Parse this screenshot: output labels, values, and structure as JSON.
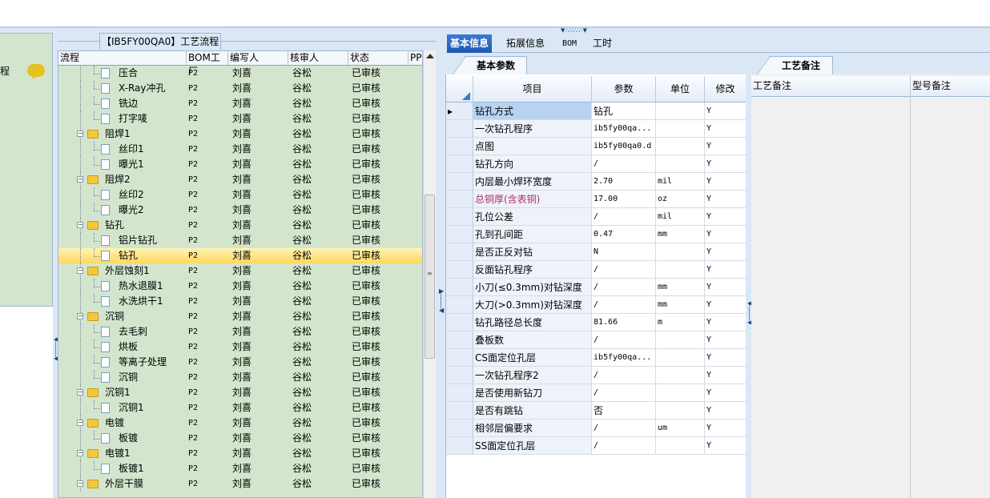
{
  "process_panel": {
    "title": "【IB5FY00QA0】工艺流程",
    "columns": [
      "流程",
      "BOM工厂",
      "编写人",
      "核审人",
      "状态",
      "PP"
    ],
    "rows": [
      {
        "name": "压合",
        "level": 2,
        "type": "doc",
        "bom": "P2",
        "author": "刘喜",
        "reviewer": "谷松",
        "status": "已审核"
      },
      {
        "name": "X-Ray冲孔",
        "level": 2,
        "type": "doc",
        "bom": "P2",
        "author": "刘喜",
        "reviewer": "谷松",
        "status": "已审核"
      },
      {
        "name": "铣边",
        "level": 2,
        "type": "doc",
        "bom": "P2",
        "author": "刘喜",
        "reviewer": "谷松",
        "status": "已审核"
      },
      {
        "name": "打字唛",
        "level": 2,
        "type": "doc",
        "bom": "P2",
        "author": "刘喜",
        "reviewer": "谷松",
        "status": "已审核"
      },
      {
        "name": "阻焊1",
        "level": 1,
        "type": "folder",
        "bom": "P2",
        "author": "刘喜",
        "reviewer": "谷松",
        "status": "已审核"
      },
      {
        "name": "丝印1",
        "level": 2,
        "type": "doc",
        "bom": "P2",
        "author": "刘喜",
        "reviewer": "谷松",
        "status": "已审核"
      },
      {
        "name": "曝光1",
        "level": 2,
        "type": "doc",
        "bom": "P2",
        "author": "刘喜",
        "reviewer": "谷松",
        "status": "已审核"
      },
      {
        "name": "阻焊2",
        "level": 1,
        "type": "folder",
        "bom": "P2",
        "author": "刘喜",
        "reviewer": "谷松",
        "status": "已审核"
      },
      {
        "name": "丝印2",
        "level": 2,
        "type": "doc",
        "bom": "P2",
        "author": "刘喜",
        "reviewer": "谷松",
        "status": "已审核"
      },
      {
        "name": "曝光2",
        "level": 2,
        "type": "doc",
        "bom": "P2",
        "author": "刘喜",
        "reviewer": "谷松",
        "status": "已审核"
      },
      {
        "name": "钻孔",
        "level": 1,
        "type": "folder",
        "bom": "P2",
        "author": "刘喜",
        "reviewer": "谷松",
        "status": "已审核"
      },
      {
        "name": "铝片钻孔",
        "level": 2,
        "type": "doc",
        "bom": "P2",
        "author": "刘喜",
        "reviewer": "谷松",
        "status": "已审核"
      },
      {
        "name": "钻孔",
        "level": 2,
        "type": "doc",
        "bom": "P2",
        "author": "刘喜",
        "reviewer": "谷松",
        "status": "已审核",
        "selected": true
      },
      {
        "name": "外层蚀刻1",
        "level": 1,
        "type": "folder",
        "bom": "P2",
        "author": "刘喜",
        "reviewer": "谷松",
        "status": "已审核"
      },
      {
        "name": "热水退膜1",
        "level": 2,
        "type": "doc",
        "bom": "P2",
        "author": "刘喜",
        "reviewer": "谷松",
        "status": "已审核"
      },
      {
        "name": "水洗烘干1",
        "level": 2,
        "type": "doc",
        "bom": "P2",
        "author": "刘喜",
        "reviewer": "谷松",
        "status": "已审核"
      },
      {
        "name": "沉铜",
        "level": 1,
        "type": "folder",
        "bom": "P2",
        "author": "刘喜",
        "reviewer": "谷松",
        "status": "已审核"
      },
      {
        "name": "去毛刺",
        "level": 2,
        "type": "doc",
        "bom": "P2",
        "author": "刘喜",
        "reviewer": "谷松",
        "status": "已审核"
      },
      {
        "name": "烘板",
        "level": 2,
        "type": "doc",
        "bom": "P2",
        "author": "刘喜",
        "reviewer": "谷松",
        "status": "已审核"
      },
      {
        "name": "等离子处理",
        "level": 2,
        "type": "doc",
        "bom": "P2",
        "author": "刘喜",
        "reviewer": "谷松",
        "status": "已审核"
      },
      {
        "name": "沉铜",
        "level": 2,
        "type": "doc",
        "bom": "P2",
        "author": "刘喜",
        "reviewer": "谷松",
        "status": "已审核"
      },
      {
        "name": "沉铜1",
        "level": 1,
        "type": "folder",
        "bom": "P2",
        "author": "刘喜",
        "reviewer": "谷松",
        "status": "已审核"
      },
      {
        "name": "沉铜1",
        "level": 2,
        "type": "doc",
        "bom": "P2",
        "author": "刘喜",
        "reviewer": "谷松",
        "status": "已审核"
      },
      {
        "name": "电镀",
        "level": 1,
        "type": "folder",
        "bom": "P2",
        "author": "刘喜",
        "reviewer": "谷松",
        "status": "已审核"
      },
      {
        "name": "板镀",
        "level": 2,
        "type": "doc",
        "bom": "P2",
        "author": "刘喜",
        "reviewer": "谷松",
        "status": "已审核"
      },
      {
        "name": "电镀1",
        "level": 1,
        "type": "folder",
        "bom": "P2",
        "author": "刘喜",
        "reviewer": "谷松",
        "status": "已审核"
      },
      {
        "name": "板镀1",
        "level": 2,
        "type": "doc",
        "bom": "P2",
        "author": "刘喜",
        "reviewer": "谷松",
        "status": "已审核"
      },
      {
        "name": "外层干膜",
        "level": 1,
        "type": "folder",
        "bom": "P2",
        "author": "刘喜",
        "reviewer": "谷松",
        "status": "已审核"
      }
    ]
  },
  "left_nav": {
    "label": "程",
    "icon": "speech-bubble-icon"
  },
  "tabs": [
    "基本信息",
    "拓展信息",
    "BOM",
    "工时"
  ],
  "basic_params": {
    "tab_label": "基本参数",
    "columns": [
      "项目",
      "参数",
      "单位",
      "修改"
    ],
    "rows": [
      {
        "item": "钻孔方式",
        "value": "钻孔",
        "unit": "",
        "mod": "Y",
        "current": true
      },
      {
        "item": "一次钻孔程序",
        "value": "ib5fy00qa...",
        "unit": "",
        "mod": "Y"
      },
      {
        "item": "点图",
        "value": "ib5fy00qa0.d",
        "unit": "",
        "mod": "Y"
      },
      {
        "item": "钻孔方向",
        "value": "/",
        "unit": "",
        "mod": "Y"
      },
      {
        "item": "内层最小焊环宽度",
        "value": "2.70",
        "unit": "mil",
        "mod": "Y"
      },
      {
        "item": "总铜厚(含表铜)",
        "value": "17.00",
        "unit": "oz",
        "mod": "Y",
        "highlight": true
      },
      {
        "item": "孔位公差",
        "value": "/",
        "unit": "mil",
        "mod": "Y"
      },
      {
        "item": "孔到孔间距",
        "value": "0.47",
        "unit": "mm",
        "mod": "Y"
      },
      {
        "item": "是否正反对钻",
        "value": "N",
        "unit": "",
        "mod": "Y"
      },
      {
        "item": "反面钻孔程序",
        "value": "/",
        "unit": "",
        "mod": "Y"
      },
      {
        "item": "小刀(≤0.3mm)对钻深度",
        "value": "/",
        "unit": "mm",
        "mod": "Y"
      },
      {
        "item": "大刀(>0.3mm)对钻深度",
        "value": "/",
        "unit": "mm",
        "mod": "Y"
      },
      {
        "item": "钻孔路径总长度",
        "value": "81.66",
        "unit": "m",
        "mod": "Y"
      },
      {
        "item": "叠板数",
        "value": "/",
        "unit": "",
        "mod": "Y"
      },
      {
        "item": "CS面定位孔层",
        "value": "ib5fy00qa...",
        "unit": "",
        "mod": "Y"
      },
      {
        "item": "一次钻孔程序2",
        "value": "/",
        "unit": "",
        "mod": "Y"
      },
      {
        "item": "是否使用新钻刀",
        "value": "/",
        "unit": "",
        "mod": "Y"
      },
      {
        "item": "是否有跳钻",
        "value": "否",
        "unit": "",
        "mod": "Y"
      },
      {
        "item": "相邻层偏要求",
        "value": "/",
        "unit": "um",
        "mod": "Y"
      },
      {
        "item": "SS面定位孔层",
        "value": "/",
        "unit": "",
        "mod": "Y"
      }
    ]
  },
  "process_notes": {
    "tab_label": "工艺备注",
    "columns": [
      "工艺备注",
      "型号备注"
    ]
  }
}
